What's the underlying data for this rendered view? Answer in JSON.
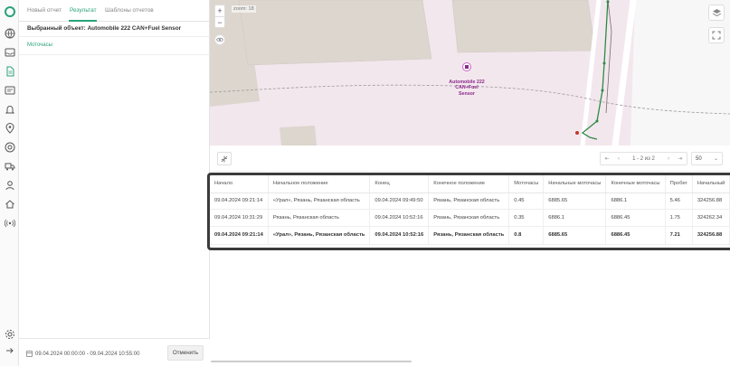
{
  "rail_icons": [
    "logo-icon",
    "globe-icon",
    "inbox-icon",
    "reports-icon",
    "messages-icon",
    "bell-icon",
    "geofence-icon",
    "routes-icon",
    "truck-icon",
    "user-icon",
    "home-icon",
    "signal-icon",
    "settings-icon",
    "logout-icon"
  ],
  "tabs": [
    {
      "label": "Новый отчет"
    },
    {
      "label": "Результат",
      "active": true
    },
    {
      "label": "Шаблоны отчетов"
    }
  ],
  "selected_object": "Выбранный объект: Automobile 222 CAN+Fuel Sensor",
  "section_link": "Моточасы",
  "bottom": {
    "date_range": "09.04.2024 00:00:00 - 09.04.2024 10:55:00",
    "cancel_label": "Отменить"
  },
  "map": {
    "zoom_in": "+",
    "zoom_out": "−",
    "zoom_text": "zoom: 18",
    "marker_label": "Automobile 222 CAN+Fuel Sensor"
  },
  "pager": {
    "first": "⇤",
    "prev": "‹",
    "info": "1 - 2 из 2",
    "next": "›",
    "last": "⇥",
    "per_page": "50"
  },
  "table": {
    "headers": [
      "Начало",
      "Начальное положение",
      "Конец",
      "Конечное положение",
      "Моточасы",
      "Начальные моточасы",
      "Конечные моточасы",
      "Пробег",
      "Начальный"
    ],
    "rows": [
      [
        "09.04.2024 09:21:14",
        "«Урал», Рязань, Рязанская область",
        "09.04.2024 09:49:50",
        "Рязань, Рязанская область",
        "0.45",
        "6885.65",
        "6886.1",
        "5.46",
        "324256.88"
      ],
      [
        "09.04.2024 10:31:29",
        "Рязань, Рязанская область",
        "09.04.2024 10:52:16",
        "Рязань, Рязанская область",
        "0.35",
        "6886.1",
        "6886.45",
        "1.75",
        "324262.34"
      ]
    ],
    "total": [
      "09.04.2024 09:21:14",
      "«Урал», Рязань, Рязанская область",
      "09.04.2024 10:52:16",
      "Рязань, Рязанская область",
      "0.8",
      "6885.65",
      "6886.45",
      "7.21",
      "324256.88"
    ]
  },
  "colors": {
    "accent": "#2aa27a",
    "map_bg": "#f3e7ee",
    "building": "#dcd6cf",
    "track": "#2d8a45",
    "table_frame": "#3b3b3b"
  }
}
